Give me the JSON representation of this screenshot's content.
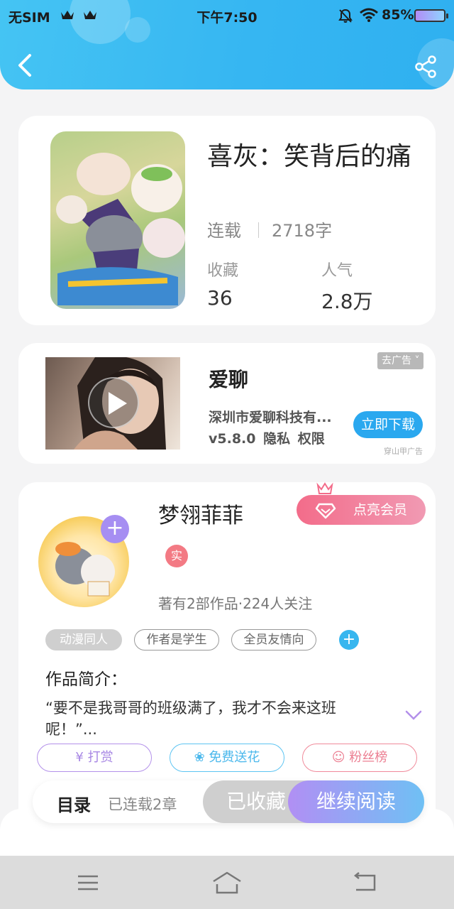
{
  "status_bar": {
    "carrier": "无SIM",
    "time": "下午7:50",
    "battery": "85%"
  },
  "header": {
    "back_icon": "chevron-left-icon",
    "share_icon": "share-icon"
  },
  "book": {
    "title": "喜灰：笑背后的痛",
    "status": "连载",
    "word_count": "2718字",
    "stats": [
      {
        "label": "收藏",
        "value": "36"
      },
      {
        "label": "人气",
        "value": "2.8万"
      }
    ]
  },
  "ad": {
    "app_name": "爱聊",
    "company": "深圳市爱聊科技有...",
    "meta": "v5.8.0 隐私 权限",
    "remove_label": "去广告",
    "download_label": "立即下载",
    "source": "穿山甲广告"
  },
  "author": {
    "name": "梦翎菲菲",
    "vip_label": "点亮会员",
    "verified_label": "实",
    "info": "著有2部作品·224人关注",
    "tags": [
      "动漫同人",
      "作者是学生",
      "全员友情向"
    ],
    "intro_title": "作品简介：",
    "intro_text": "“要不是我哥哥的班级满了，我才不会来这班呢！”...",
    "actions": [
      "打赏",
      "免费送花",
      "粉丝榜"
    ]
  },
  "reading_bar": {
    "toc_label": "目录",
    "chapter_count": "已连载2章",
    "collected_label": "已收藏",
    "continue_label": "继续阅读"
  },
  "colors": {
    "header": "#36b6f2",
    "accent_purple": "#a68ef2",
    "vip_pink": "#f36c8a",
    "download_blue": "#2aa8ef"
  }
}
